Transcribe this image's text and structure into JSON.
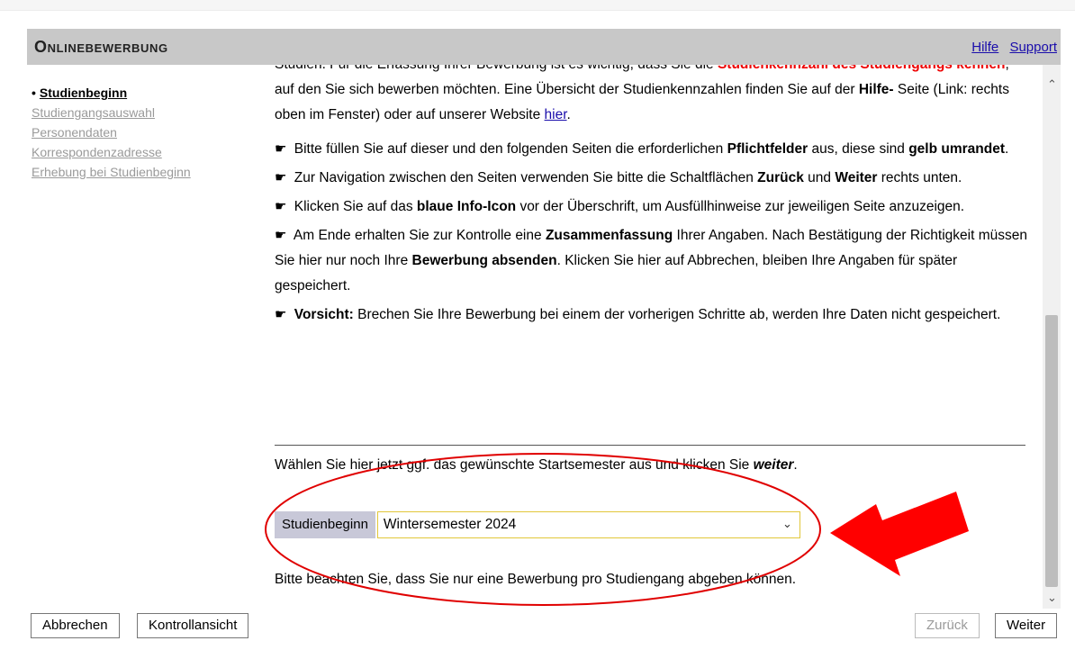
{
  "header": {
    "title": "Onlinebewerbung",
    "links": [
      {
        "label": "Hilfe"
      },
      {
        "label": "Support"
      }
    ]
  },
  "sidebar": {
    "items": [
      {
        "label": "Studienbeginn",
        "active": true
      },
      {
        "label": "Studiengangsauswahl",
        "active": false
      },
      {
        "label": "Personendaten",
        "active": false
      },
      {
        "label": "Korrespondenzadresse",
        "active": false
      },
      {
        "label": "Erhebung bei Studienbeginn",
        "active": false
      }
    ]
  },
  "content": {
    "intro": {
      "t1": "Studien. Für die Erfassung Ihrer Bewerbung ist es wichtig, dass Sie die",
      "t2": "Studienkennzahl des Studiengangs kennen",
      "t3": ", auf den Sie sich bewerben möchten. Eine Übersicht der Studienkennzahlen finden Sie auf der",
      "t4": "Hilfe-",
      "t5": "Seite (Link: rechts oben im Fenster) oder auf unserer Website",
      "link": "hier",
      "t6": "."
    },
    "bullets": [
      {
        "a": "Bitte füllen Sie auf dieser und den folgenden Seiten die erforderlichen",
        "b": "Pflichtfelder",
        "c": "aus, diese sind",
        "d": "gelb umrandet",
        "e": "."
      },
      {
        "a": "Zur Navigation zwischen den Seiten verwenden Sie bitte die Schaltflächen",
        "b": "Zurück",
        "c": "und",
        "d": "Weiter",
        "e": "rechts unten."
      },
      {
        "a": "Klicken Sie auf das",
        "b": "blaue Info-Icon",
        "c": "vor der Überschrift, um Ausfüllhinweise zur jeweiligen Seite anzuzeigen.",
        "d": "",
        "e": ""
      },
      {
        "a": "Am Ende erhalten Sie zur Kontrolle eine",
        "b": "Zusammenfassung",
        "c": "Ihrer Angaben. Nach Bestätigung der Richtigkeit müssen Sie hier nur noch Ihre",
        "d": "Bewerbung absenden",
        "e": ". Klicken Sie hier auf Abbrechen, bleiben Ihre Angaben für später gespeichert."
      },
      {
        "a": "",
        "b": "Vorsicht:",
        "c": "Brechen Sie Ihre Bewerbung bei einem der vorherigen Schritte ab, werden Ihre Daten nicht gespeichert.",
        "d": "",
        "e": ""
      }
    ],
    "choose": {
      "text": "Wählen Sie hier jetzt ggf. das gewünschte Startsemester aus und klicken Sie",
      "emph": "weiter",
      "end": "."
    },
    "field": {
      "label": "Studienbeginn",
      "value": "Wintersemester 2024"
    },
    "note": "Bitte beachten Sie, dass Sie nur eine Bewerbung pro Studiengang abgeben können."
  },
  "footer": {
    "cancel": "Abbrechen",
    "control": "Kontrollansicht",
    "back": "Zurück",
    "next": "Weiter"
  },
  "annotation": {
    "color": "#e00000"
  },
  "icons": {
    "hand": "pointing-hand-icon",
    "up": "chevron-up-icon",
    "down": "chevron-down-icon"
  }
}
